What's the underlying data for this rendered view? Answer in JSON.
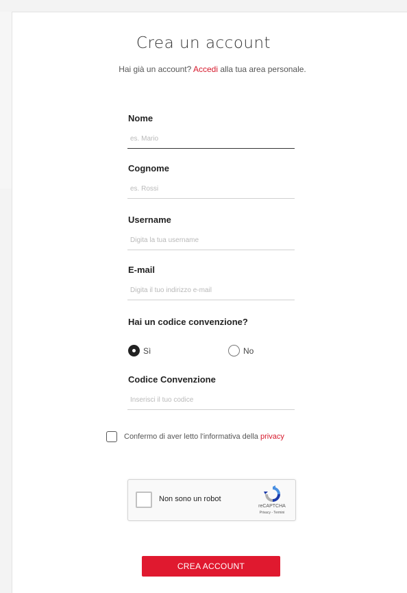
{
  "header": {
    "title": "Crea un account",
    "subtitle_before": "Hai già un account?",
    "subtitle_link": "Accedi",
    "subtitle_after": "alla tua area personale."
  },
  "form": {
    "nome": {
      "label": "Nome",
      "placeholder": "es. Mario",
      "value": ""
    },
    "cognome": {
      "label": "Cognome",
      "placeholder": "es. Rossi",
      "value": ""
    },
    "username": {
      "label": "Username",
      "placeholder": "Digita la tua username",
      "value": ""
    },
    "email": {
      "label": "E-mail",
      "placeholder": "Digita il tuo indirizzo e-mail",
      "value": ""
    },
    "convention_question": "Hai un codice convenzione?",
    "radio_yes": {
      "label": "Sì",
      "checked": true
    },
    "radio_no": {
      "label": "No",
      "checked": false
    },
    "codice": {
      "label": "Codice Convenzione",
      "placeholder": "Inserisci il tuo codice",
      "value": ""
    },
    "consent": {
      "text": "Confermo di aver letto l'informativa della",
      "link": "privacy",
      "checked": false
    }
  },
  "recaptcha": {
    "label": "Non sono un robot",
    "brand": "reCAPTCHA",
    "links": "Privacy - Termini"
  },
  "submit_label": "CREA ACCOUNT",
  "colors": {
    "accent": "#e0192f",
    "link": "#d6182b"
  }
}
